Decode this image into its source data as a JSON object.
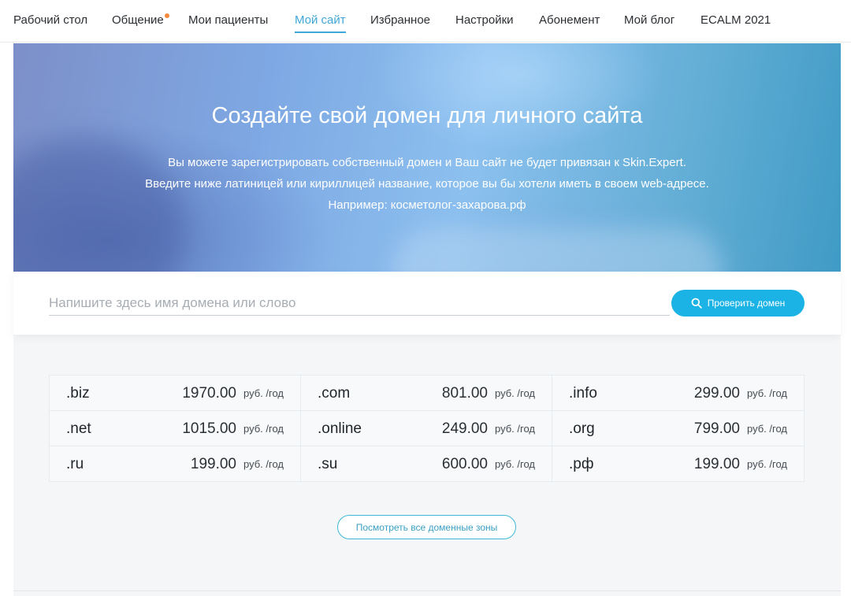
{
  "nav": {
    "items": [
      {
        "label": "Рабочий стол"
      },
      {
        "label": "Общение"
      },
      {
        "label": "Мои пациенты"
      },
      {
        "label": "Мой сайт"
      },
      {
        "label": "Избранное"
      },
      {
        "label": "Настройки"
      },
      {
        "label": "Абонемент"
      },
      {
        "label": "Мой блог"
      },
      {
        "label": "ECALM 2021"
      }
    ],
    "active": "Мой сайт",
    "accent_color": "#3fa6d8",
    "notification_color": "#f28a3c"
  },
  "hero": {
    "title": "Создайте свой домен для личного сайта",
    "line1": "Вы можете зарегистрировать собственный домен и Ваш сайт не будет привязан к Skin.Expert.",
    "line2": "Введите ниже латиницей или кириллицей название, которое вы бы хотели иметь в своем web-адресе.",
    "line3": "Например: косметолог-захарова.рф"
  },
  "search": {
    "placeholder": "Напишите здесь имя домена или слово",
    "value": "",
    "button_label": "Проверить домен",
    "button_icon": "search-icon",
    "button_color": "#1bb3e6"
  },
  "zones": [
    {
      "name": ".biz",
      "price": "1970.00",
      "unit": "руб. /год"
    },
    {
      "name": ".com",
      "price": "801.00",
      "unit": "руб. /год"
    },
    {
      "name": ".info",
      "price": "299.00",
      "unit": "руб. /год"
    },
    {
      "name": ".net",
      "price": "1015.00",
      "unit": "руб. /год"
    },
    {
      "name": ".online",
      "price": "249.00",
      "unit": "руб. /год"
    },
    {
      "name": ".org",
      "price": "799.00",
      "unit": "руб. /год"
    },
    {
      "name": ".ru",
      "price": "199.00",
      "unit": "руб. /год"
    },
    {
      "name": ".su",
      "price": "600.00",
      "unit": "руб. /год"
    },
    {
      "name": ".рф",
      "price": "199.00",
      "unit": "руб. /год"
    }
  ],
  "all_zones_label": "Посмотреть все доменные зоны"
}
